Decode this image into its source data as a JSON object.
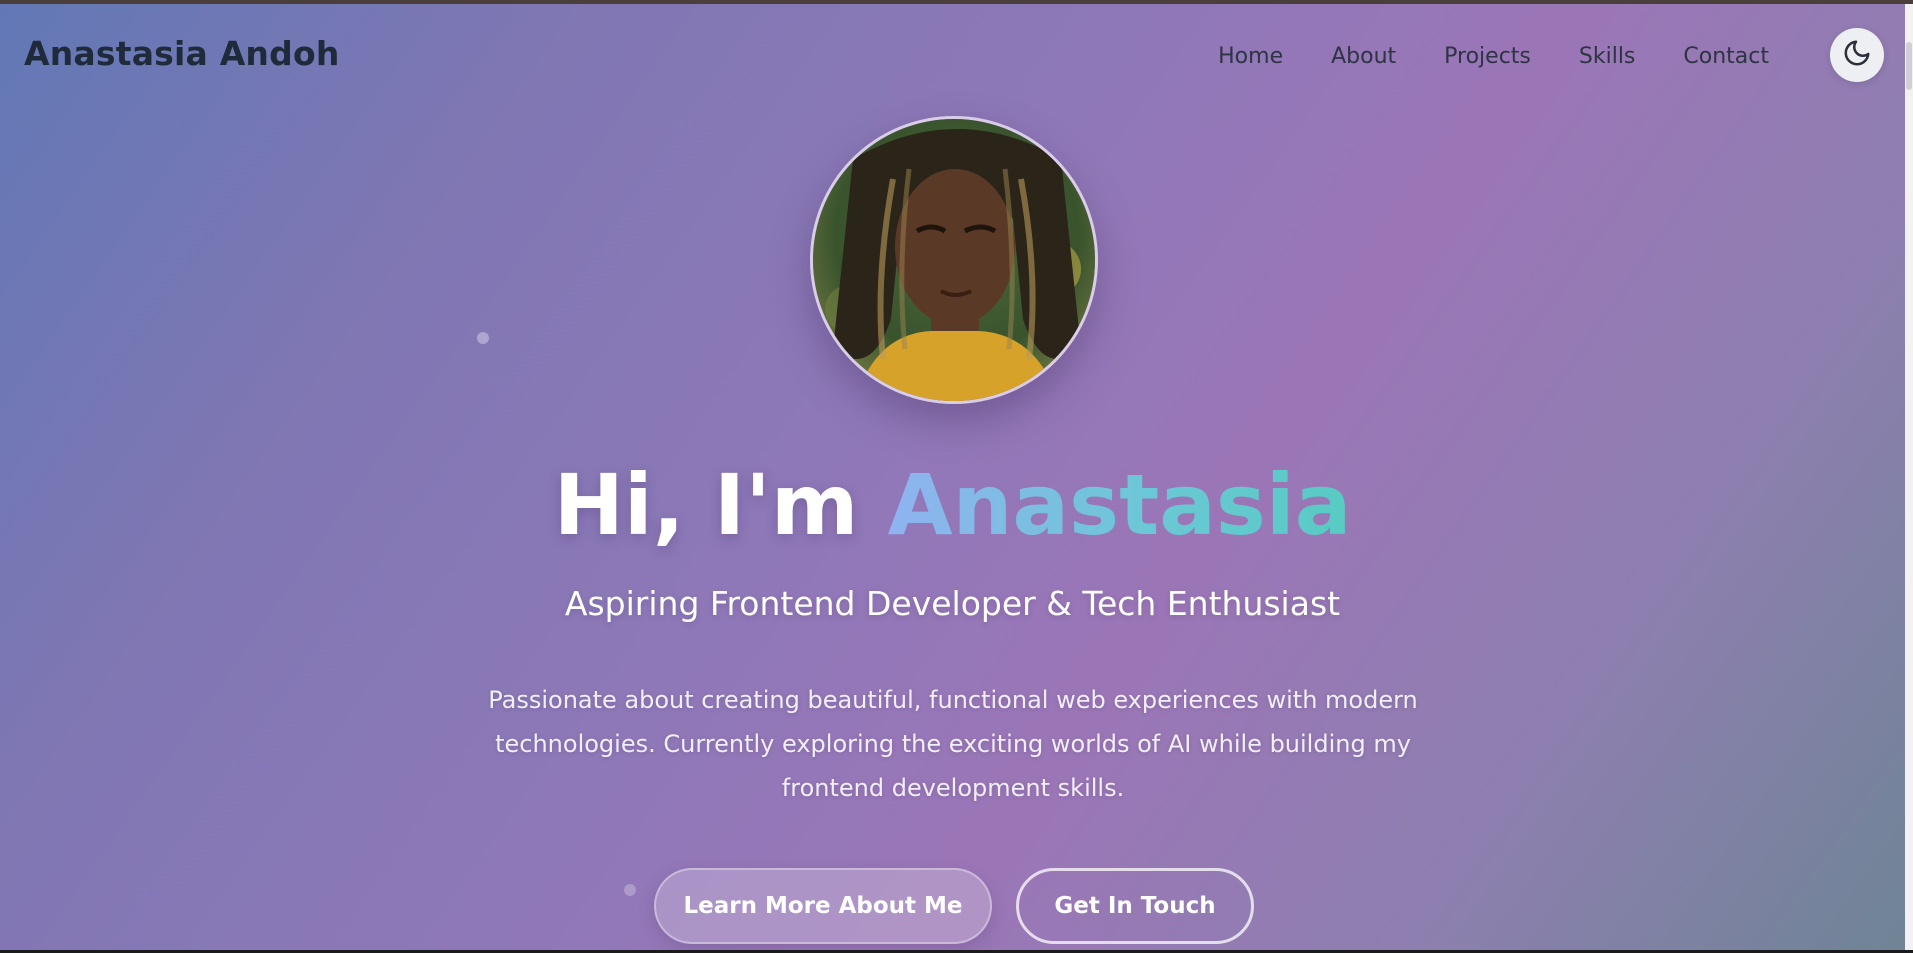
{
  "brand": "Anastasia Andoh",
  "nav": {
    "items": [
      {
        "label": "Home"
      },
      {
        "label": "About"
      },
      {
        "label": "Projects"
      },
      {
        "label": "Skills"
      },
      {
        "label": "Contact"
      }
    ],
    "theme_toggle_icon": "moon-icon"
  },
  "hero": {
    "greeting": "Hi, I'm",
    "name": "Anastasia",
    "subtitle": "Aspiring Frontend Developer & Tech Enthusiast",
    "description": "Passionate about creating beautiful, functional web experiences with modern technologies. Currently exploring the exciting worlds of AI while building my frontend development skills.",
    "buttons": {
      "primary": "Learn More About Me",
      "secondary": "Get In Touch"
    }
  },
  "colors": {
    "brand_text": "#1f2a3a",
    "gradient_start": "#6278b6",
    "gradient_mid": "#9b76b7",
    "gradient_end": "#6f8496",
    "name_gradient_start": "#8fb3f0",
    "name_gradient_end": "#57cbc2"
  }
}
